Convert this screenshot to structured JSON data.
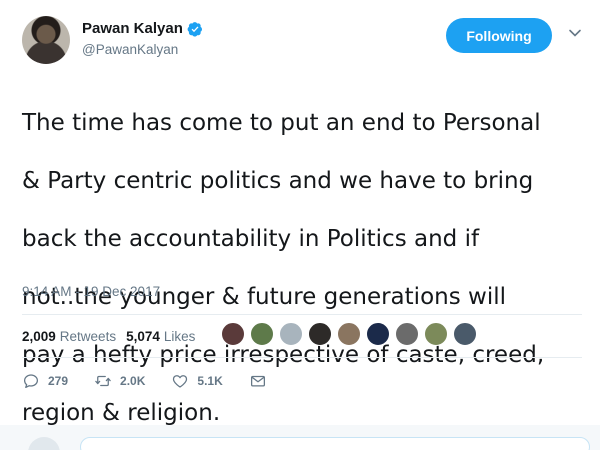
{
  "user": {
    "name": "Pawan Kalyan",
    "handle": "@PawanKalyan",
    "follow_label": "Following"
  },
  "tweet": {
    "text_lines": [
      "The time has come to put an end to Personal",
      "& Party centric politics and we have to  bring",
      "back the accountability in Politics and if",
      "not..the younger & future generations will",
      "pay a hefty price irrespective of caste, creed,",
      "region & religion."
    ],
    "timestamp": "9:14 AM - 19 Dec 2017"
  },
  "stats": {
    "retweets_count": "2,009",
    "retweets_label": "Retweets",
    "likes_count": "5,074",
    "likes_label": "Likes"
  },
  "likers": {
    "avatar_colors": [
      "#5a3a3a",
      "#5e7a4a",
      "#a8b4bd",
      "#2d2a28",
      "#8a7560",
      "#1b2a4a",
      "#6b6b6b",
      "#7c8a5a",
      "#4a5a6a"
    ]
  },
  "actions": {
    "reply_count": "279",
    "retweet_count": "2.0K",
    "like_count": "5.1K"
  },
  "colors": {
    "accent": "#1da1f2",
    "secondary_text": "#657786"
  }
}
